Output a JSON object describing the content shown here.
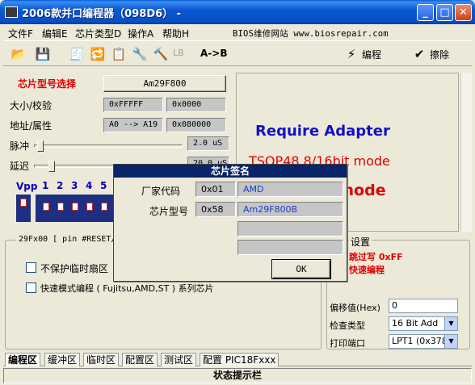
{
  "window": {
    "title": "2006款并口编程器（098D6） -",
    "min_glyph": "_",
    "max_glyph": "□",
    "close_glyph": "✕"
  },
  "menu": {
    "items": [
      "文件F",
      "编辑E",
      "芯片类型D",
      "操作A",
      "帮助H"
    ],
    "site": "BIOS维修网站 www.biosrepair.com"
  },
  "toolbar": {
    "lb_label": "LB",
    "ab_label": "A->B",
    "program_label": "编程",
    "erase_label": "擦除"
  },
  "chip": {
    "select_label": "芯片型号选择",
    "model_button": "Am29F800",
    "size_label": "大小/校验",
    "size_value": "0xFFFFF",
    "checksum_value": "0x0000",
    "address_label": "地址/属性",
    "address_value": "A0 --> A19",
    "attr_value": "0x080000",
    "pulse_label": "脉冲",
    "pulse_value": "2.0 uS",
    "delay_label": "延迟",
    "delay_value": "20.0 uS",
    "vpp_label": "Vpp",
    "dip_numbers": [
      "1",
      "2",
      "3",
      "4",
      "5"
    ]
  },
  "adapter": {
    "title": "Require Adapter",
    "line1": "TSOP48 8/16bit mode",
    "line2": "16bit mode"
  },
  "bottom": {
    "pin_note": "29Fx00 [ pin #RESET/",
    "no_protect_label": "不保护临时扇区",
    "fast_mode_label": "快速模式编程 ( Fujitsu,AMD,ST ) 系列芯片",
    "settings_label": "设置",
    "skip_label": "跳过写 0xFF",
    "fast_prog_label": "快速编程",
    "offset_label": "偏移值(Hex)",
    "offset_value": "0",
    "check_label": "检查类型",
    "check_value": "16 Bit Add",
    "port_label": "打印端口",
    "port_value": "LPT1 (0x378)"
  },
  "tabs": [
    "编程区",
    "缓冲区",
    "临时区",
    "配置区",
    "测试区",
    "配置 PIC18Fxxx"
  ],
  "status_bar": "状态提示栏",
  "dialog": {
    "title": "芯片签名",
    "vendor_label": "厂家代码",
    "vendor_code": "0x01",
    "vendor_name": "AMD",
    "chip_label": "芯片型号",
    "chip_code": "0x58",
    "chip_name": "Am29F800B",
    "ok_label": "OK"
  },
  "colors": {
    "accent_red": "#e00000",
    "adapter_blue": "#1010c8",
    "titlebar_blue": "#0a58d0",
    "dialog_title_bg": "#0a246a"
  }
}
